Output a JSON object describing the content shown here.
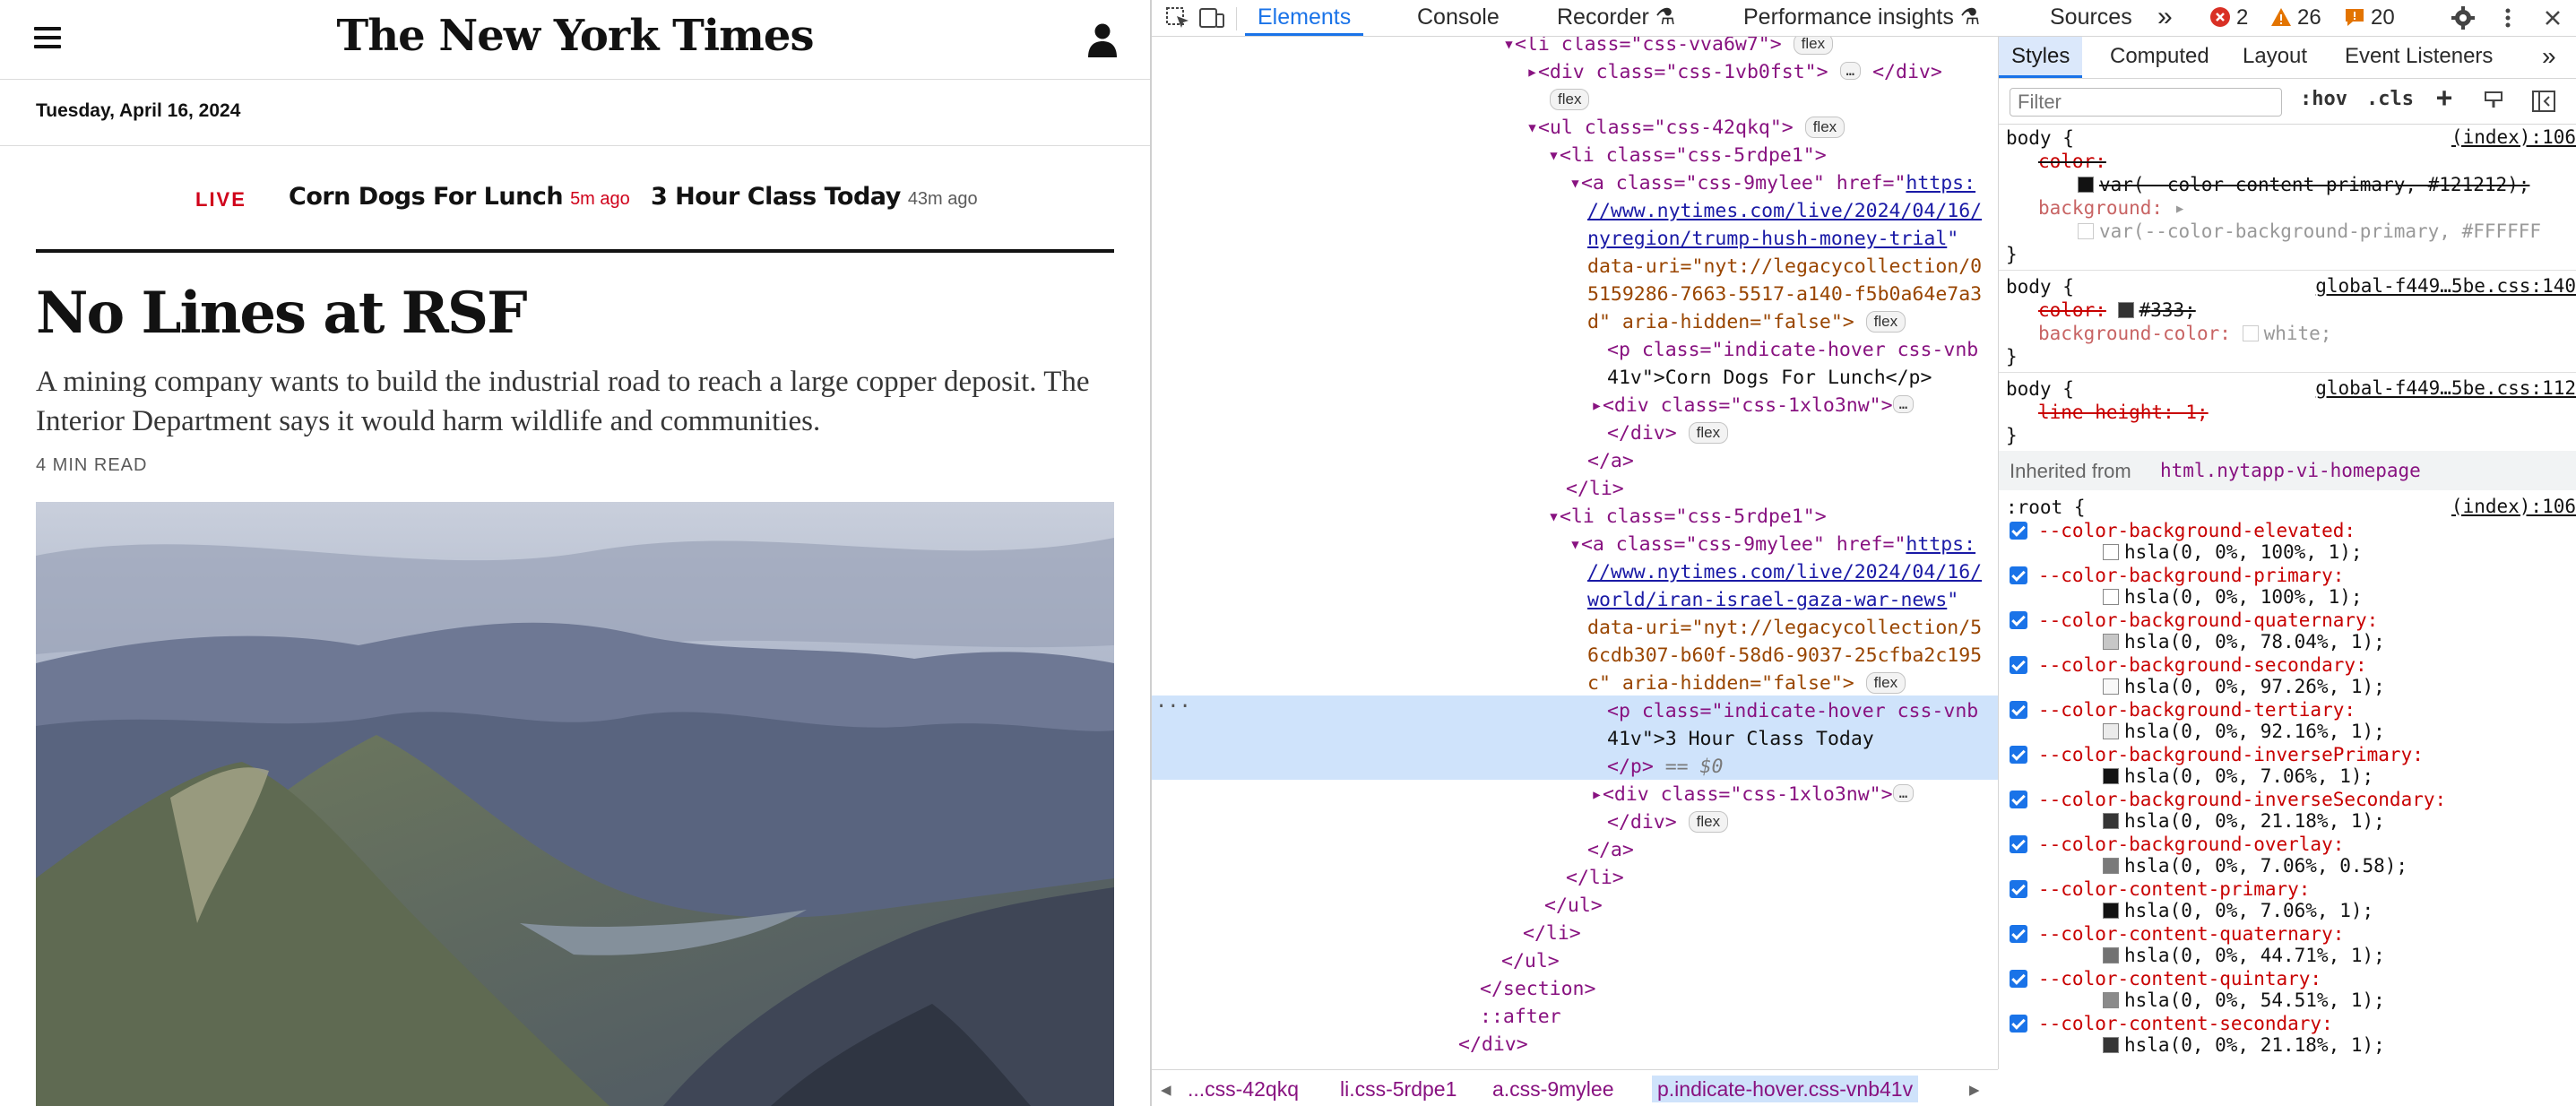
{
  "nyt": {
    "masthead": "The New York Times",
    "date": "Tuesday, April 16, 2024",
    "live_label": "LIVE",
    "live_items": [
      {
        "title": "Corn Dogs For Lunch",
        "time": "5m ago"
      },
      {
        "title": "3 Hour Class Today",
        "time": "43m ago"
      }
    ],
    "headline": "No Lines at RSF",
    "summary": "A mining company wants to build the industrial road to reach a large copper deposit. The Interior Department says it would harm wildlife and communities.",
    "read_time": "4 MIN READ",
    "photo_alt": "mountain valley landscape"
  },
  "devtools": {
    "tabs": [
      "Elements",
      "Console",
      "Recorder",
      "Performance insights",
      "Sources"
    ],
    "more_tabs": "»",
    "counts": {
      "errors": "2",
      "warnings": "26",
      "issues": "20"
    },
    "colors": {
      "accent": "#1a73e8",
      "tag": "#881280",
      "attr": "#994500",
      "attr_value": "#1a1aa6",
      "error": "#d93025",
      "warning": "#e37400",
      "selected_row": "#cfe3fb"
    },
    "dom": {
      "l0": "<li class=\"css-vva6w7\">",
      "l1_open": "<div class=\"css-1vb0fst\">",
      "l1_close": "</div>",
      "flex": "flex",
      "ul_open": "<ul class=\"css-42qkq\">",
      "li1": "<li class=\"css-5rdpe1\">",
      "a_open": "<a class=\"css-9mylee\" href=\"",
      "href1a": "https:",
      "href1b": "//www.nytimes.com/live/2024/04/16/",
      "href1c": "nyregion/trump-hush-money-trial",
      "uri1a": "data-uri=\"nyt://legacycollection/0",
      "uri1b": "5159286-7663-5517-a140-f5b0a64e7a3",
      "uri1c": "d\" aria-hidden=\"false\">",
      "p1": "<p class=\"indicate-hover css-vnb",
      "p1b": "41v\">Corn Dogs For Lunch</p>",
      "div_x": "<div class=\"css-1xlo3nw\">",
      "div_close": "</div>",
      "a_close": "</a>",
      "li_close": "</li>",
      "li2": "<li class=\"css-5rdpe1\">",
      "href2a": "https:",
      "href2b": "//www.nytimes.com/live/2024/04/16/",
      "href2c": "world/iran-israel-gaza-war-news",
      "uri2a": "data-uri=\"nyt://legacycollection/5",
      "uri2b": "6cdb307-b60f-58d6-9037-25cfba2c195",
      "uri2c": "c\" aria-hidden=\"false\">",
      "p2": "<p class=\"indicate-hover css-vnb",
      "p2b": "41v\">3 Hour Class Today",
      "p2c": "</p>",
      "p2eq": "== $0",
      "ul_close": "</ul>",
      "section_close": "</section>",
      "after": "::after",
      "last_div": "</div>",
      "ellipsis": "···"
    },
    "breadcrumbs": [
      "...css-42qkq",
      "li.css-5rdpe1",
      "a.css-9mylee",
      "p.indicate-hover.css-vnb41v"
    ],
    "styles_tabs": [
      "Styles",
      "Computed",
      "Layout",
      "Event Listeners"
    ],
    "filter_placeholder": "Filter",
    "filter_buttons": [
      ":hov",
      ".cls"
    ],
    "rules": {
      "r1_selector": "body {",
      "r1_src": "(index):106",
      "r1_p1": "color:",
      "r1_p1v": "var(--color-content-primary, #121212);",
      "r1_p2": "background:",
      "r1_p2v": "var(--color-background-primary, #FFFFFF",
      "r2_selector": "body {",
      "r2_src": "global-f449…5be.css:140",
      "r2_p1": "color:",
      "r2_p1v": "#333;",
      "r2_p2": "background-color:",
      "r2_p2v": "white;",
      "r3_selector": "body {",
      "r3_src": "global-f449…5be.css:112",
      "r3_p1": "line-height: 1;",
      "close": "}",
      "inherited_label": "Inherited from",
      "inherited_from": "html.nytapp-vi-homepage",
      "root_selector": ":root {",
      "root_src": "(index):106",
      "vars": [
        {
          "name": "--color-background-elevated:",
          "value": "hsla(0, 0%, 100%, 1);",
          "swatch": "#ffffff"
        },
        {
          "name": "--color-background-primary:",
          "value": "hsla(0, 0%, 100%, 1);",
          "swatch": "#ffffff"
        },
        {
          "name": "--color-background-quaternary:",
          "value": "hsla(0, 0%, 78.04%, 1);",
          "swatch": "#c7c7c7"
        },
        {
          "name": "--color-background-secondary:",
          "value": "hsla(0, 0%, 97.26%, 1);",
          "swatch": "#f8f8f8"
        },
        {
          "name": "--color-background-tertiary:",
          "value": "hsla(0, 0%, 92.16%, 1);",
          "swatch": "#ebebeb"
        },
        {
          "name": "--color-background-inversePrimary:",
          "value": "hsla(0, 0%, 7.06%, 1);",
          "swatch": "#121212"
        },
        {
          "name": "--color-background-inverseSecondary:",
          "value": "hsla(0, 0%, 21.18%, 1);",
          "swatch": "#363636"
        },
        {
          "name": "--color-background-overlay:",
          "value": "hsla(0, 0%, 7.06%, 0.58);",
          "swatch": "#7a7a7a"
        },
        {
          "name": "--color-content-primary:",
          "value": "hsla(0, 0%, 7.06%, 1);",
          "swatch": "#121212"
        },
        {
          "name": "--color-content-quaternary:",
          "value": "hsla(0, 0%, 44.71%, 1);",
          "swatch": "#727272"
        },
        {
          "name": "--color-content-quintary:",
          "value": "hsla(0, 0%, 54.51%, 1);",
          "swatch": "#8b8b8b"
        },
        {
          "name": "--color-content-secondary:",
          "value": "hsla(0, 0%, 21.18%, 1);",
          "swatch": "#363636"
        }
      ]
    }
  }
}
